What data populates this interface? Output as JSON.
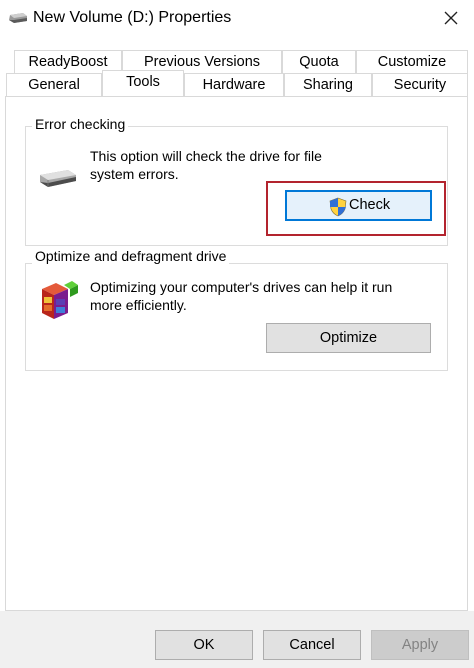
{
  "window": {
    "title": "New Volume (D:) Properties",
    "close_glyph": "✕",
    "icon": "drive-icon"
  },
  "tabs_row1": [
    {
      "label": "ReadyBoost"
    },
    {
      "label": "Previous Versions"
    },
    {
      "label": "Quota"
    },
    {
      "label": "Customize"
    }
  ],
  "tabs_row2": [
    {
      "label": "General"
    },
    {
      "label": "Tools",
      "active": true
    },
    {
      "label": "Hardware"
    },
    {
      "label": "Sharing"
    },
    {
      "label": "Security"
    }
  ],
  "error_checking": {
    "group_label": "Error checking",
    "description": "This option will check the drive for file system errors.",
    "button_label": "Check",
    "button_icon": "uac-shield-icon",
    "icon": "drive-icon",
    "highlight_color": "#b3242e"
  },
  "optimize": {
    "group_label": "Optimize and defragment drive",
    "description": "Optimizing your computer's drives can help it run more efficiently.",
    "button_label": "Optimize",
    "icon": "defragment-icon"
  },
  "footer": {
    "ok_label": "OK",
    "cancel_label": "Cancel",
    "apply_label": "Apply"
  },
  "colors": {
    "accent": "#0078d7",
    "highlight": "#b3242e",
    "button_face": "#e1e1e1",
    "footer_bg": "#f0f0f0"
  }
}
